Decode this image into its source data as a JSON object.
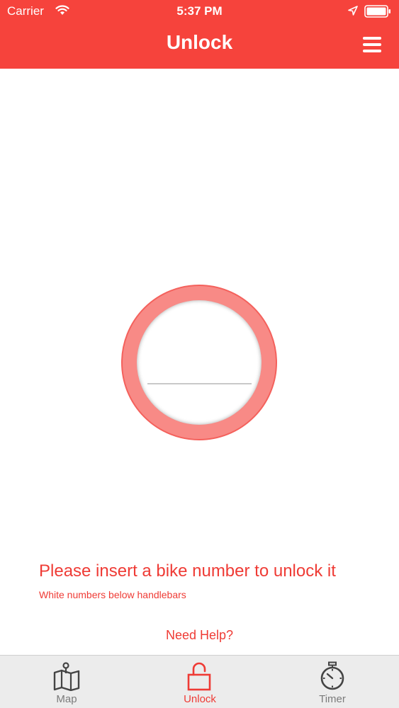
{
  "status_bar": {
    "carrier": "Carrier",
    "time": "5:37 PM",
    "wifi_icon": "wifi-icon",
    "location_icon": "location-arrow-icon",
    "battery_icon": "battery-full-icon"
  },
  "nav": {
    "title": "Unlock",
    "menu_icon": "hamburger-menu-icon"
  },
  "unlock": {
    "bike_number_value": "",
    "instruction": "Please insert a bike number to unlock it",
    "hint": "White numbers below handlebars",
    "help_link": "Need Help?"
  },
  "tabs": [
    {
      "label": "Map",
      "icon": "map-icon",
      "active": false
    },
    {
      "label": "Unlock",
      "icon": "unlock-icon",
      "active": true
    },
    {
      "label": "Timer",
      "icon": "stopwatch-icon",
      "active": false
    }
  ],
  "colors": {
    "brand_red": "#f6433c",
    "text_red": "#ef3b35",
    "ring_fill": "#f88a86",
    "tab_bar_bg": "#ececec",
    "inactive_tab": "#7b7b7b"
  }
}
